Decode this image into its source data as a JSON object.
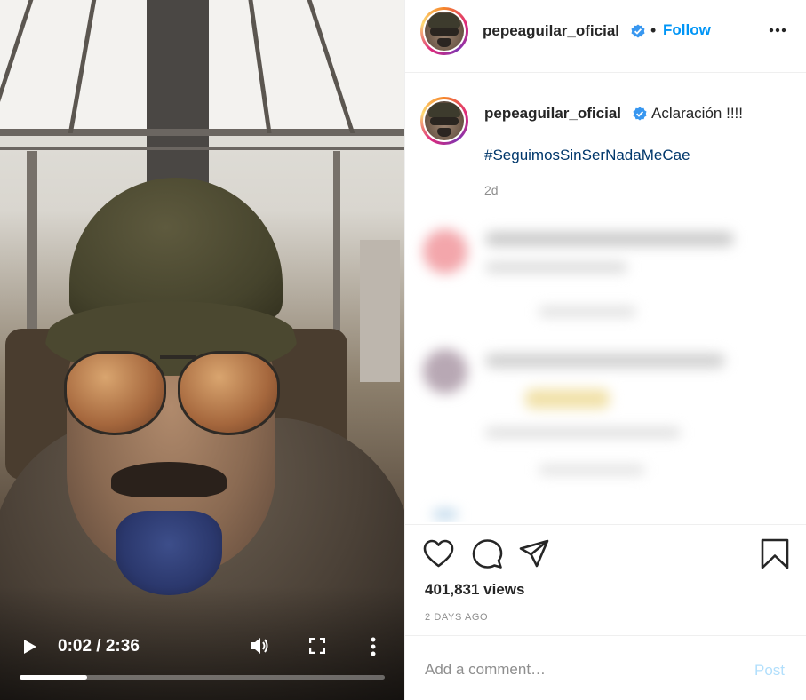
{
  "video": {
    "time_display": "0:02 / 2:36",
    "progress_fraction": 0.185,
    "play_icon": "play-icon",
    "volume_icon": "volume-icon",
    "fullscreen_icon": "fullscreen-icon",
    "more_icon": "more-vertical-icon"
  },
  "header": {
    "username": "pepeaguilar_oficial",
    "separator": "•",
    "follow_label": "Follow",
    "options_icon": "more-horizontal-icon"
  },
  "caption": {
    "username": "pepeaguilar_oficial",
    "text": "Aclaración !!!!",
    "hashtag": "#SeguimosSinSerNadaMeCae",
    "age": "2d"
  },
  "actions": {
    "like_icon": "heart-icon",
    "comment_icon": "comment-icon",
    "share_icon": "share-icon",
    "save_icon": "bookmark-icon",
    "views": "401,831 views",
    "timestamp": "2 DAYS AGO"
  },
  "comment": {
    "placeholder": "Add a comment…",
    "post_label": "Post"
  },
  "colors": {
    "accent": "#0095f6",
    "verified": "#3897f0",
    "hashtag": "#00376b",
    "post_disabled": "#b2dffc",
    "muted": "#8e8e8e"
  }
}
